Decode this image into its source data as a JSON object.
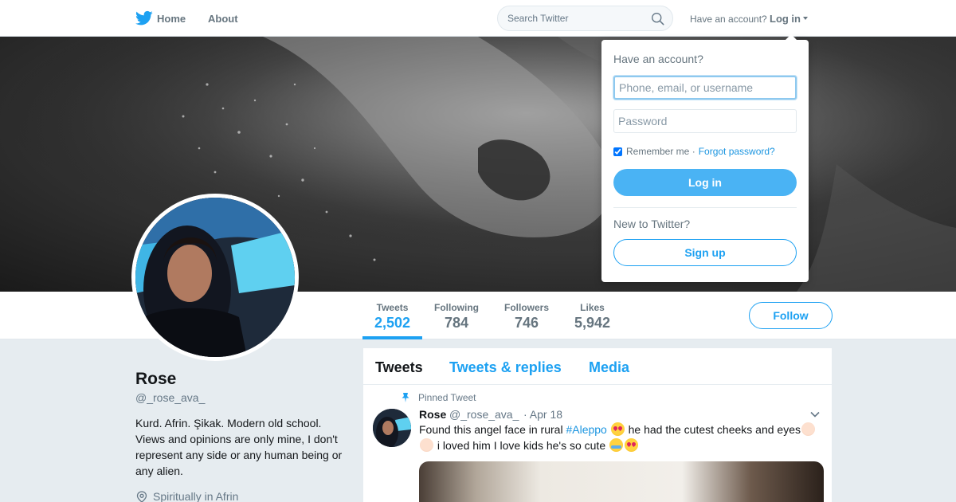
{
  "nav": {
    "logo_icon": "twitter-bird-icon",
    "home_label": "Home",
    "about_label": "About",
    "search_placeholder": "Search Twitter",
    "search_icon": "search-icon",
    "have_account_text": "Have an account?",
    "login_label": "Log in"
  },
  "profile": {
    "name": "Rose",
    "handle": "@_rose_ava_",
    "bio": "Kurd. Afrin. Şikak. Modern old school. Views and opinions are only mine, I don't represent any side or any human being or any alien.",
    "location": "Spiritually in Afrin",
    "follow_label": "Follow"
  },
  "stats": [
    {
      "label": "Tweets",
      "value": "2,502",
      "active": true
    },
    {
      "label": "Following",
      "value": "784",
      "active": false
    },
    {
      "label": "Followers",
      "value": "746",
      "active": false
    },
    {
      "label": "Likes",
      "value": "5,942",
      "active": false
    }
  ],
  "timeline": {
    "tabs": [
      {
        "label": "Tweets",
        "active": true
      },
      {
        "label": "Tweets & replies",
        "active": false
      },
      {
        "label": "Media",
        "active": false
      }
    ],
    "pinned_label": "Pinned Tweet",
    "tweet": {
      "author": "Rose",
      "handle": "@_rose_ava_",
      "date": "· Apr 18",
      "text_part1": "Found this angel face in rural",
      "hashtag": "#Aleppo",
      "text_part2": "he had the cutest cheeks and eyes",
      "text_part3": "i loved him I love kids he's so cute"
    }
  },
  "login_dropdown": {
    "title": "Have an account?",
    "username_placeholder": "Phone, email, or username",
    "password_placeholder": "Password",
    "remember_label": "Remember me ·",
    "forgot_label": "Forgot password?",
    "login_button": "Log in",
    "new_label": "New to Twitter?",
    "signup_button": "Sign up"
  },
  "colors": {
    "accent": "#1da1f2",
    "login_button_bg": "#4ab3f4",
    "background": "#e6ecf0"
  }
}
